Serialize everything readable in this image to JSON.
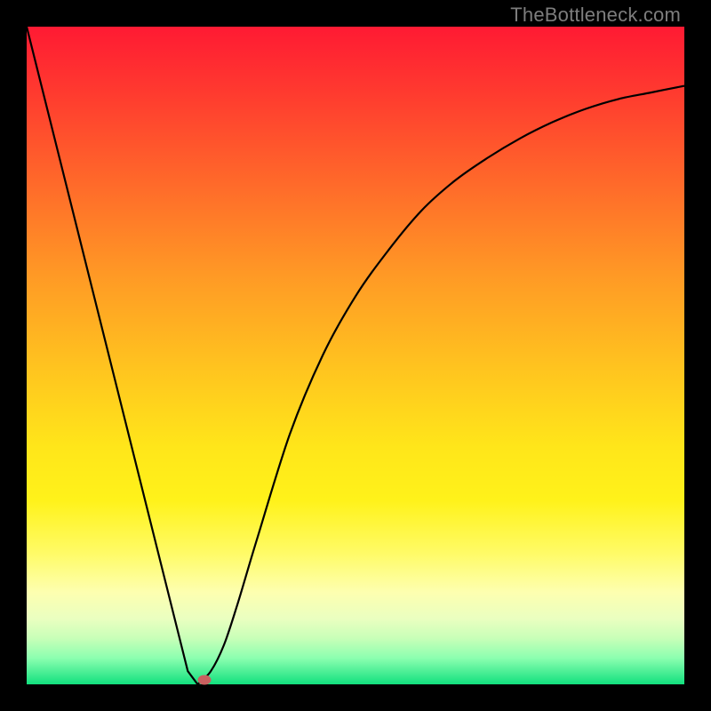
{
  "watermark": "TheBottleneck.com",
  "colors": {
    "frame": "#000000",
    "curve": "#000000",
    "marker": "#c96060"
  },
  "chart_data": {
    "type": "line",
    "title": "",
    "xlabel": "",
    "ylabel": "",
    "x": [
      0.0,
      0.05,
      0.1,
      0.15,
      0.2,
      0.245,
      0.26,
      0.28,
      0.3,
      0.32,
      0.35,
      0.4,
      0.45,
      0.5,
      0.55,
      0.6,
      0.65,
      0.7,
      0.75,
      0.8,
      0.85,
      0.9,
      0.95,
      1.0
    ],
    "values": [
      1.0,
      0.8,
      0.6,
      0.4,
      0.2,
      0.02,
      0.0,
      0.02,
      0.06,
      0.12,
      0.22,
      0.38,
      0.5,
      0.59,
      0.66,
      0.72,
      0.765,
      0.8,
      0.83,
      0.855,
      0.875,
      0.89,
      0.9,
      0.91
    ],
    "min_at_x": 0.27,
    "xlim": [
      0,
      1
    ],
    "ylim": [
      0,
      1
    ],
    "grid": false,
    "legend": false
  }
}
